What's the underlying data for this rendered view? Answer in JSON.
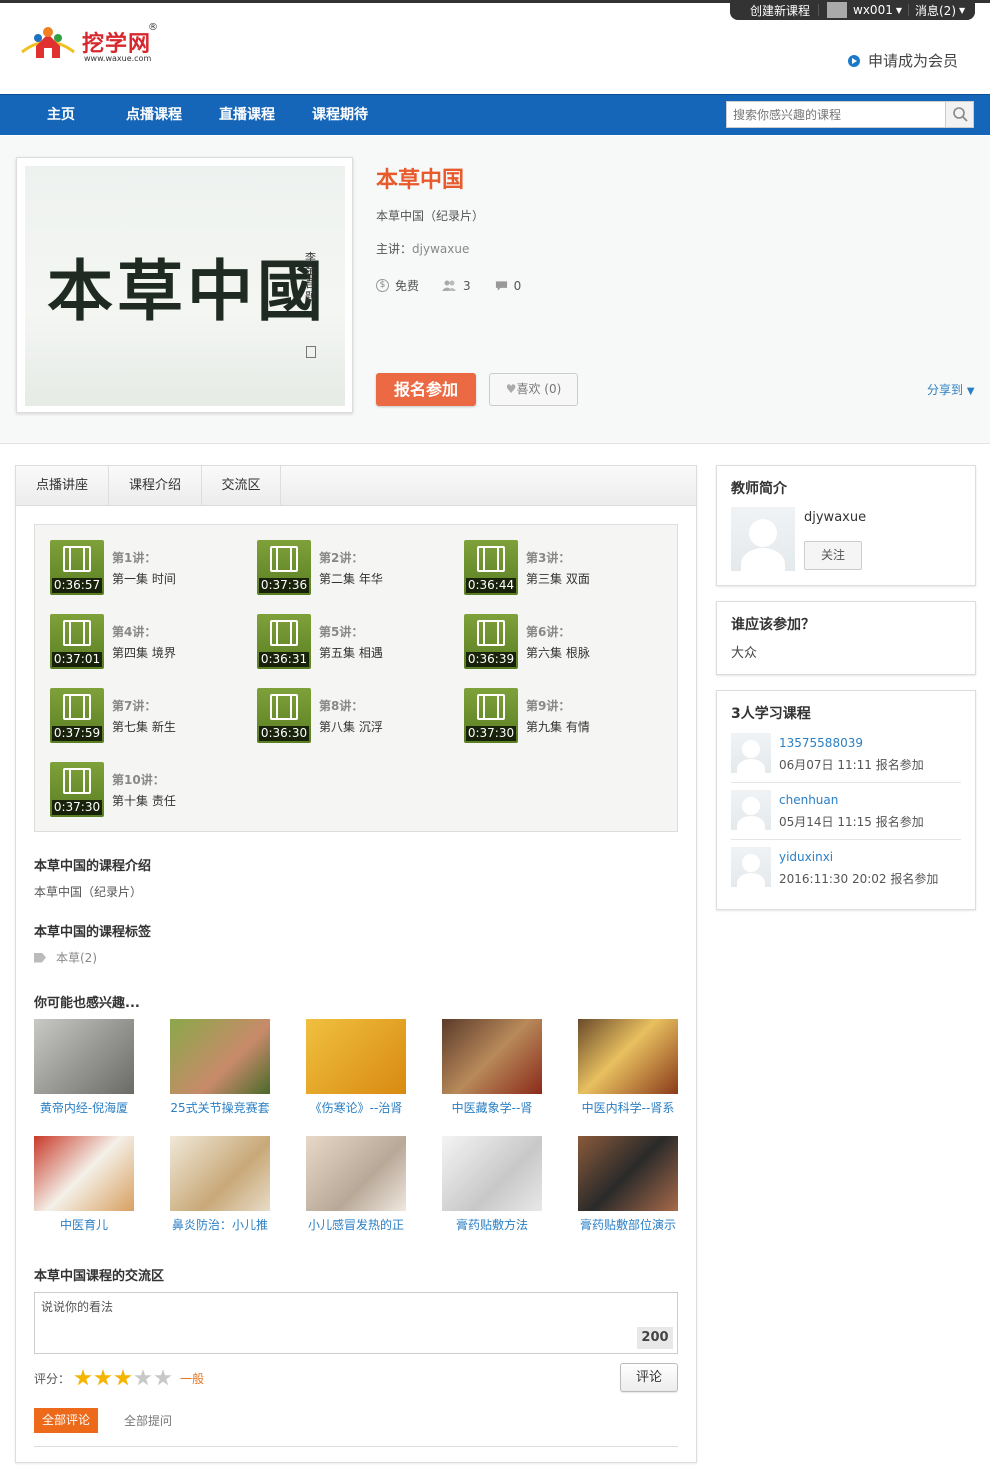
{
  "topbar": {
    "create": "创建新课程",
    "user": "wx001",
    "messages": "消息(2)"
  },
  "logo": {
    "name": "挖学网",
    "url": "www.waxue.com",
    "reg": "®"
  },
  "header": {
    "member": "申请成为会员"
  },
  "nav": {
    "items": [
      "主页",
      "点播课程",
      "直播课程",
      "课程期待"
    ]
  },
  "search": {
    "placeholder": "搜索你感兴趣的课程"
  },
  "course": {
    "cover_text": "本草中國",
    "title": "本草中国",
    "subtitle": "本草中国（纪录片）",
    "lecturer_label": "主讲：",
    "lecturer": "djywaxue",
    "price": "免费",
    "students": "3",
    "comments": "0",
    "join": "报名参加",
    "like": "喜欢 (0)",
    "share": "分享到"
  },
  "tabs": [
    "点播讲座",
    "课程介绍",
    "交流区"
  ],
  "lectures": [
    {
      "num": "第1讲：",
      "name": "第一集 时间",
      "dur": "0:36:57"
    },
    {
      "num": "第2讲：",
      "name": "第二集 年华",
      "dur": "0:37:36"
    },
    {
      "num": "第3讲：",
      "name": "第三集 双面",
      "dur": "0:36:44"
    },
    {
      "num": "第4讲：",
      "name": "第四集 境界",
      "dur": "0:37:01"
    },
    {
      "num": "第5讲：",
      "name": "第五集 相遇",
      "dur": "0:36:31"
    },
    {
      "num": "第6讲：",
      "name": "第六集 根脉",
      "dur": "0:36:39"
    },
    {
      "num": "第7讲：",
      "name": "第七集 新生",
      "dur": "0:37:59"
    },
    {
      "num": "第8讲：",
      "name": "第八集 沉浮",
      "dur": "0:36:30"
    },
    {
      "num": "第9讲：",
      "name": "第九集 有情",
      "dur": "0:37:30"
    },
    {
      "num": "第10讲：",
      "name": "第十集 责任",
      "dur": "0:37:30"
    }
  ],
  "intro": {
    "heading": "本草中国的课程介绍",
    "text": "本草中国（纪录片）"
  },
  "tags": {
    "heading": "本草中国的课程标签",
    "tag": "本草(2)"
  },
  "recommend": {
    "heading": "你可能也感兴趣...",
    "items": [
      {
        "caption": "黄帝内经-倪海厦",
        "color": "#8a8a86"
      },
      {
        "caption": "25式关节操竞赛套",
        "color": "#6a8a3a"
      },
      {
        "caption": "《伤寒论》--治肾",
        "color": "#e0a020"
      },
      {
        "caption": "中医藏象学--肾",
        "color": "#7a5a3a"
      },
      {
        "caption": "中医内科学--肾系",
        "color": "#9a6a3a"
      },
      {
        "caption": "中医育儿",
        "color": "#b84a2a"
      },
      {
        "caption": "鼻炎防治：小儿推",
        "color": "#d8c8a8"
      },
      {
        "caption": "小儿感冒发热的正",
        "color": "#c8b8a8"
      },
      {
        "caption": "膏药贴敷方法",
        "color": "#d8d8d8"
      },
      {
        "caption": "膏药贴敷部位演示",
        "color": "#7a4a2a"
      }
    ]
  },
  "comments": {
    "heading": "本草中国课程的交流区",
    "placeholder": "说说你的看法",
    "count": "200",
    "rating_label": "评分：",
    "rating_text": "一般",
    "rating": 3,
    "submit": "评论",
    "tab_all": "全部评论",
    "tab_questions": "全部提问"
  },
  "teacher": {
    "heading": "教师简介",
    "name": "djywaxue",
    "follow": "关注"
  },
  "audience": {
    "heading": "谁应该参加？",
    "text": "大众"
  },
  "learners": {
    "heading": "3人学习课程",
    "items": [
      {
        "name": "13575588039",
        "time": "06月07日 11:11 报名参加"
      },
      {
        "name": "chenhuan",
        "time": "05月14日 11:15 报名参加"
      },
      {
        "name": "yiduxinxi",
        "time": "2016:11:30 20:02 报名参加"
      }
    ]
  },
  "colors": {
    "nav": "#1565b8",
    "accent": "#ec6a43",
    "link": "#2b7fc4",
    "green": "#6a8f2c"
  }
}
